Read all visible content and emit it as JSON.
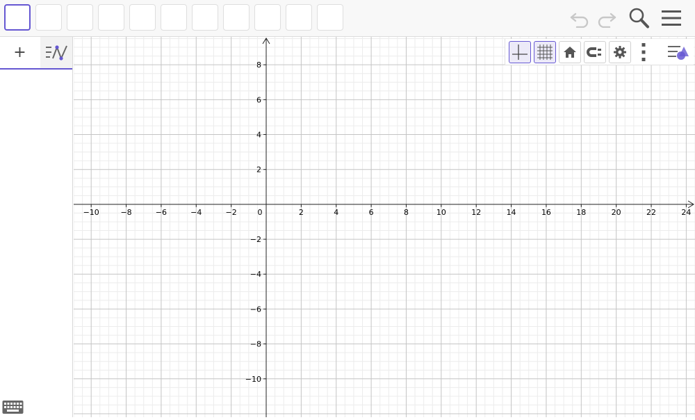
{
  "toolbar": {
    "tools": [
      "move-tool",
      "point-tool",
      "line-tool",
      "perpendicular-tool",
      "polygon-tool",
      "circle-tool",
      "ellipse-tool",
      "angle-tool",
      "reflect-tool",
      "slider-tool",
      "move-graphics-tool"
    ],
    "selected_index": 0,
    "right_icons": [
      "undo-icon",
      "redo-icon",
      "search-icon",
      "menu-icon"
    ]
  },
  "algebra": {
    "tabs": [
      {
        "name": "add-input-tab",
        "icon": "plus-icon",
        "label": "+"
      },
      {
        "name": "algebra-view-tab",
        "icon": "algebra-graph-icon"
      }
    ]
  },
  "graph_toolbar": {
    "buttons": [
      "axes-toggle",
      "grid-toggle",
      "home-view",
      "point-capture",
      "graphics-settings",
      "more-options",
      "style-bar-toggle"
    ]
  },
  "chart_data": {
    "type": "coordinate-grid",
    "xlim": [
      -11,
      24.5
    ],
    "ylim": [
      -12.2,
      9.6
    ],
    "grid": true,
    "minor_grid": true,
    "x_ticks": [
      "−10",
      "−8",
      "−6",
      "−4",
      "−2",
      "0",
      "2",
      "4",
      "6",
      "8",
      "10",
      "12",
      "14",
      "16",
      "18",
      "20",
      "22",
      "24"
    ],
    "y_ticks": [
      "8",
      "6",
      "4",
      "2",
      "−2",
      "−4",
      "−6",
      "−8",
      "−10"
    ],
    "origin_label": "0"
  }
}
